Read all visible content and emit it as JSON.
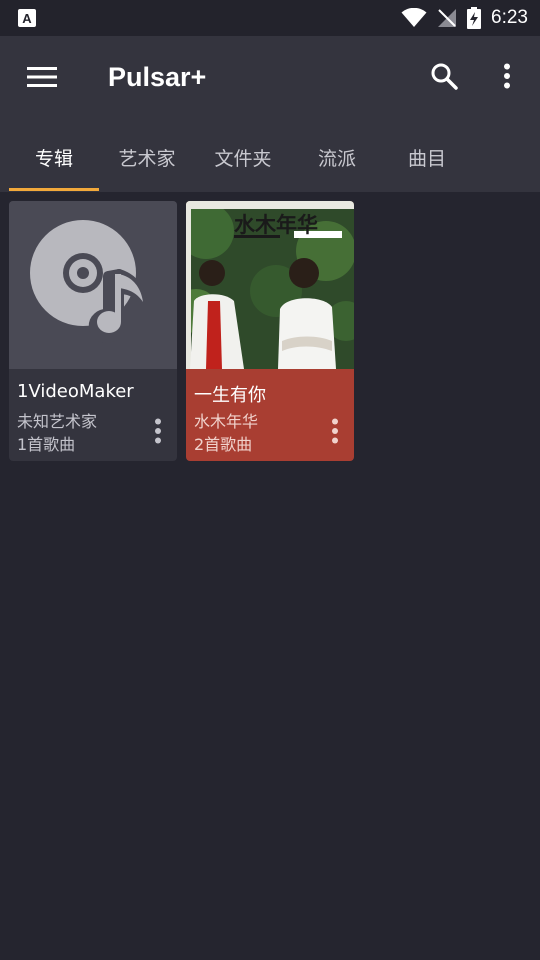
{
  "status_bar": {
    "notification_icon": "A",
    "time": "6:23",
    "icons": [
      "wifi-icon",
      "no-signal-icon",
      "battery-charging-icon"
    ]
  },
  "app_bar": {
    "title": "Pulsar+",
    "icons": [
      "menu-icon",
      "search-icon",
      "more-vert-icon"
    ]
  },
  "tabs": [
    {
      "label": "专辑",
      "active": true
    },
    {
      "label": "艺术家",
      "active": false
    },
    {
      "label": "文件夹",
      "active": false
    },
    {
      "label": "流派",
      "active": false
    },
    {
      "label": "曲目",
      "active": false
    }
  ],
  "albums": [
    {
      "title": "1VideoMaker",
      "artist": "未知艺术家",
      "count": "1首歌曲",
      "art": "music-disc-icon",
      "card_color": "#34343e"
    },
    {
      "title": "一生有你",
      "artist": "水木年华",
      "count": "2首歌曲",
      "art": "album-cover-photo",
      "cover_text": "水木年华",
      "card_color": "#a93e32"
    }
  ],
  "colors": {
    "background": "#25252f",
    "app_bar": "#34343e",
    "accent": "#f2a93b"
  }
}
